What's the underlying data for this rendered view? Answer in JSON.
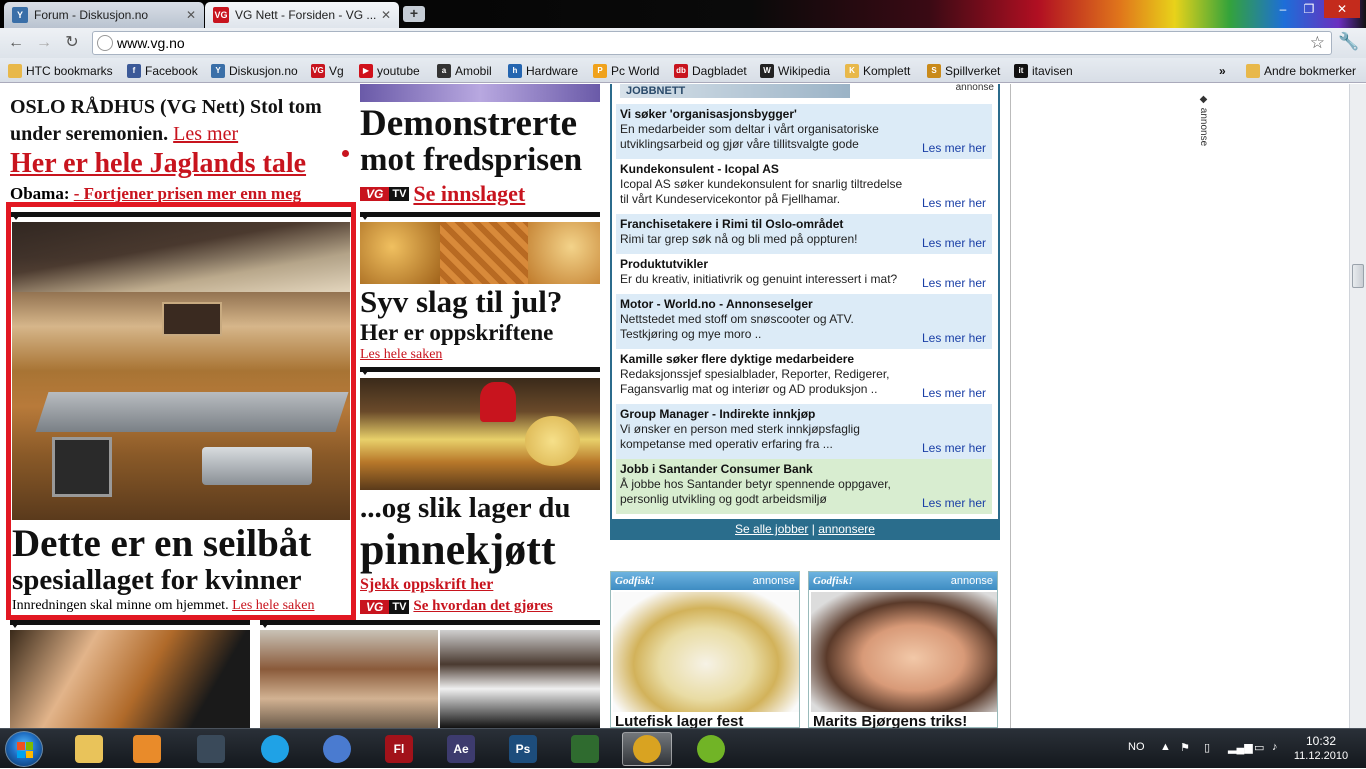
{
  "browser": {
    "tabs": [
      {
        "title": "Forum - Diskusjon.no",
        "active": false
      },
      {
        "title": "VG Nett - Forsiden - VG ...",
        "active": true
      }
    ],
    "new_tab": "+",
    "window_buttons": {
      "minimize": "‒",
      "maximize": "❐",
      "close": "✕"
    },
    "url": "www.vg.no",
    "bookmarks": [
      {
        "label": "HTC bookmarks",
        "icon": "folder-icon"
      },
      {
        "label": "Facebook",
        "icon": "facebook-icon"
      },
      {
        "label": "Diskusjon.no",
        "icon": "diskusjon-icon"
      },
      {
        "label": "Vg",
        "icon": "vg-icon"
      },
      {
        "label": "youtube",
        "icon": "youtube-icon"
      },
      {
        "label": "Amobil",
        "icon": "amobil-icon"
      },
      {
        "label": "Hardware",
        "icon": "hardware-icon"
      },
      {
        "label": "Pc World",
        "icon": "pcworld-icon"
      },
      {
        "label": "Dagbladet",
        "icon": "dagbladet-icon"
      },
      {
        "label": "Wikipedia",
        "icon": "wikipedia-icon"
      },
      {
        "label": "Komplett",
        "icon": "komplett-icon"
      },
      {
        "label": "Spillverket",
        "icon": "spillverket-icon"
      },
      {
        "label": "itavisen",
        "icon": "itavisen-icon"
      }
    ],
    "bookmarks_overflow": "»",
    "other_bookmarks": "Andre bokmerker"
  },
  "page": {
    "col1": {
      "top_text": "OSLO RÅDHUS (VG Nett) Stol tom under seremonien.",
      "top_link": "Les mer",
      "tale_link": "Her er hele Jaglands tale",
      "obama_label": "Obama:",
      "obama_link": "- Fortjener prisen mer enn meg",
      "boat_headline_1": "Dette er en seilbåt",
      "boat_headline_2": "spesiallaget for kvinner",
      "boat_text": "Innredningen skal minne om hjemmet.",
      "boat_link": "Les hele saken"
    },
    "col2": {
      "headline_1": "Demonstrerte",
      "headline_2": "mot fredsprisen",
      "vgtv_vg": "VG",
      "vgtv_tv": "TV",
      "se_innslaget": "Se innslaget",
      "jul_headline": "Syv slag til jul?",
      "jul_sub": "Her er oppskriftene",
      "jul_link": "Les hele saken",
      "pinne_1": "...og slik lager du",
      "pinne_2": "pinnekjøtt",
      "pinne_link": "Sjekk oppskrift her",
      "pinne_video": "Se hvordan det gjøres"
    },
    "jobs": {
      "logo": "JOBBNETT",
      "annonse": "annonse",
      "items": [
        {
          "title": "Vi søker 'organisasjonsbygger'",
          "text": "En medarbeider som deltar i vårt organisatoriske utviklingsarbeid og gjør våre tillitsvalgte gode",
          "more": "Les mer her"
        },
        {
          "title": "Kundekonsulent - Icopal AS",
          "text": "Icopal AS søker kundekonsulent for snarlig tiltredelse til vårt Kundeservicekontor på Fjellhamar.",
          "more": "Les mer her"
        },
        {
          "title": "Franchisetakere i Rimi til Oslo-området",
          "text": "Rimi tar grep  søk nå og bli med på oppturen!",
          "more": "Les mer her"
        },
        {
          "title": "Produktutvikler",
          "text": "Er du kreativ, initiativrik og genuint interessert i mat?",
          "more": "Les mer her"
        },
        {
          "title": "Motor - World.no - Annonseselger",
          "text": "Nettstedet med stoff om snøscooter og ATV. Testkjøring og mye moro ..",
          "more": "Les mer her"
        },
        {
          "title": "Kamille søker flere dyktige medarbeidere",
          "text": "Redaksjonssjef spesialblader, Reporter, Redigerer, Fagansvarlig mat og interiør og AD produksjon ..",
          "more": "Les mer her"
        },
        {
          "title": "Group Manager - Indirekte innkjøp",
          "text": "Vi ønsker en person med sterk innkjøpsfaglig kompetanse med operativ erfaring fra ...",
          "more": "Les mer her"
        },
        {
          "title": "Jobb i Santander Consumer Bank",
          "text": "Å jobbe hos Santander betyr spennende oppgaver, personlig utvikling og godt arbeidsmiljø",
          "more": "Les mer her"
        }
      ],
      "footer_all": "Se alle jobber",
      "footer_sep": "|",
      "footer_ad": "annonsere"
    },
    "ads": [
      {
        "brand": "Godfisk!",
        "label": "annonse",
        "caption": "Lutefisk lager fest"
      },
      {
        "brand": "Godfisk!",
        "label": "annonse",
        "caption": "Marits Bjørgens triks!"
      }
    ],
    "side_annonse": "annonse"
  },
  "taskbar": {
    "apps": [
      {
        "name": "explorer-icon",
        "label": "",
        "color": "#e9c35a"
      },
      {
        "name": "media-player-icon",
        "label": "",
        "color": "#e98b2a"
      },
      {
        "name": "phone-icon",
        "label": "",
        "color": "#3a4a5a"
      },
      {
        "name": "skype-icon",
        "label": "",
        "color": "#1fa2e6"
      },
      {
        "name": "itunes-icon",
        "label": "",
        "color": "#4a7bd0"
      },
      {
        "name": "flash-icon",
        "label": "Fl",
        "color": "#a2121a"
      },
      {
        "name": "after-effects-icon",
        "label": "Ae",
        "color": "#3d3b6e"
      },
      {
        "name": "photoshop-icon",
        "label": "Ps",
        "color": "#1d4d7c"
      },
      {
        "name": "network-app-icon",
        "label": "",
        "color": "#2f6b2f"
      },
      {
        "name": "chrome-icon",
        "label": "",
        "color": "#d9a321"
      },
      {
        "name": "spotify-icon",
        "label": "",
        "color": "#71b426"
      }
    ],
    "tray_lang": "NO",
    "time": "10:32",
    "date": "11.12.2010"
  }
}
